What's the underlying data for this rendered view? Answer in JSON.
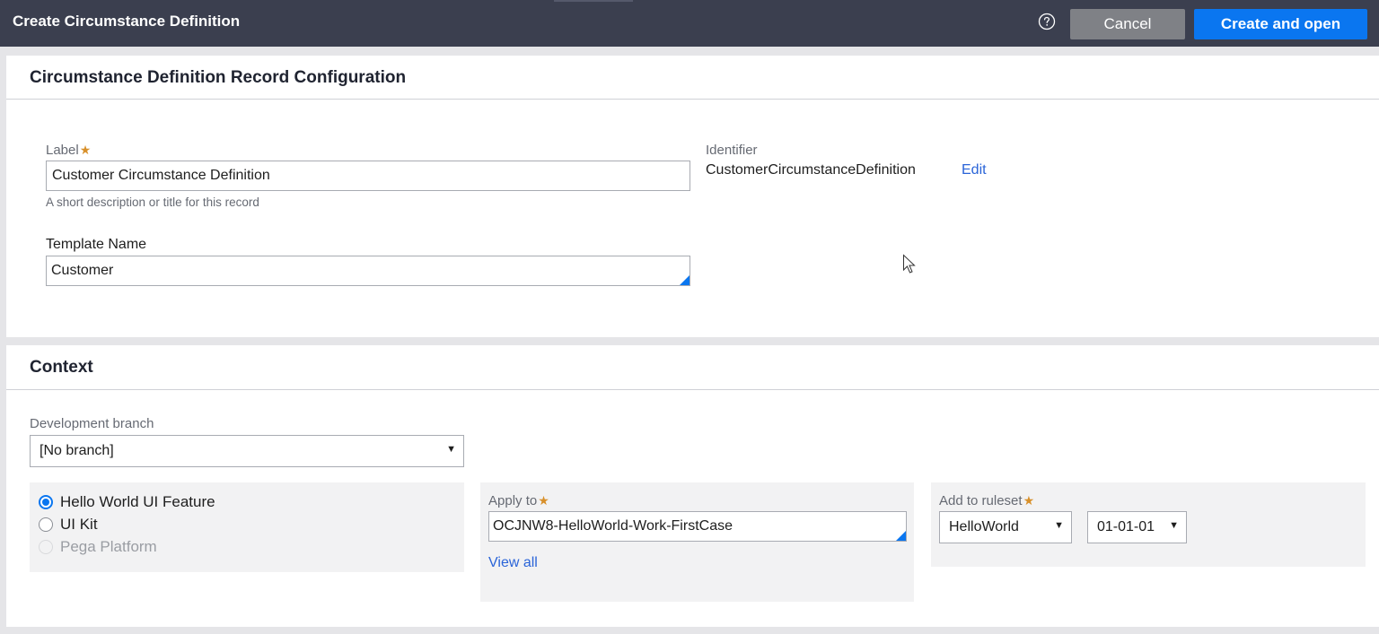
{
  "header": {
    "title": "Create Circumstance Definition",
    "help_icon": "question-circle-icon",
    "cancel_label": "Cancel",
    "create_label": "Create and open"
  },
  "record_config": {
    "heading": "Circumstance Definition Record Configuration",
    "label_field": {
      "label": "Label",
      "value": "Customer Circumstance Definition",
      "help": "A short description or title for this record"
    },
    "identifier": {
      "label": "Identifier",
      "value": "CustomerCircumstanceDefinition",
      "edit_label": "Edit"
    },
    "template_name": {
      "label": "Template Name",
      "value": "Customer"
    }
  },
  "context": {
    "heading": "Context",
    "branch": {
      "label": "Development branch",
      "value": "[No branch]"
    },
    "layers": [
      {
        "label": "Hello World UI Feature",
        "checked": true,
        "disabled": false
      },
      {
        "label": "UI Kit",
        "checked": false,
        "disabled": false
      },
      {
        "label": "Pega Platform",
        "checked": false,
        "disabled": true
      }
    ],
    "apply_to": {
      "label": "Apply to",
      "value": "OCJNW8-HelloWorld-Work-FirstCase",
      "view_all_label": "View all"
    },
    "ruleset": {
      "label": "Add to ruleset",
      "value": "HelloWorld",
      "version": "01-01-01"
    }
  },
  "colors": {
    "header_bg": "#3b3f4f",
    "primary": "#0a76f0",
    "cancel_bg": "#7f8186",
    "required": "#d8902a",
    "link": "#2a64d8"
  }
}
